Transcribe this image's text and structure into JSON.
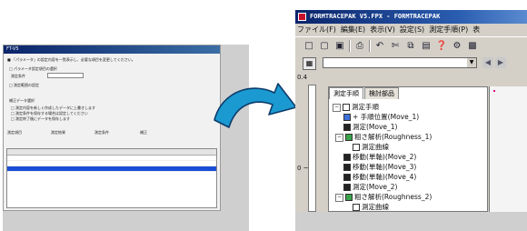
{
  "left_dialog": {
    "title": "FT-V5",
    "lines": [
      "■ 「パラメータ」の設定内容を一覧表示し、必要な項目を変更してください。",
      "□ パラメータ設定項目の選択",
      "測定条件",
      "□ 測定範囲の設定",
      "補正データ選択",
      "□ 測定内容を新しく作成したデータに上書きします",
      "□ 測定条件を保存する場合は設定してください",
      "□ 測定終了後にデータを保存します"
    ],
    "table_headers": [
      "測定項目",
      "測定結果",
      "測定条件",
      "補正"
    ]
  },
  "app": {
    "title": "FORMTRACEPAK V5.FPX - FORMTRACEPAK",
    "menu": [
      "ファイル(F)",
      "編集(E)",
      "表示(V)",
      "設定(S)",
      "測定手順(P)",
      "表"
    ],
    "ruler_labels": [
      "0.4",
      "0 ~"
    ],
    "tabs": [
      "測定手順",
      "検討部品"
    ],
    "tree": [
      {
        "label": "測定手順",
        "depth": 0,
        "toggle": "−",
        "icon": "list"
      },
      {
        "label": "+ 手順位置(Move_1)",
        "depth": 1,
        "toggle": "",
        "icon": "move"
      },
      {
        "label": "測定(Move_1)",
        "depth": 1,
        "toggle": "",
        "icon": "measure"
      },
      {
        "label": "粗さ解析(Roughness_1)",
        "depth": 1,
        "toggle": "−",
        "icon": "analysis"
      },
      {
        "label": "測定曲線",
        "depth": 2,
        "toggle": "",
        "icon": "curve"
      },
      {
        "label": "移動(単軸)(Move_2)",
        "depth": 1,
        "toggle": "",
        "icon": "axis"
      },
      {
        "label": "移動(単軸)(Move_3)",
        "depth": 1,
        "toggle": "",
        "icon": "axis"
      },
      {
        "label": "移動(単軸)(Move_4)",
        "depth": 1,
        "toggle": "",
        "icon": "axis"
      },
      {
        "label": "測定(Move_2)",
        "depth": 1,
        "toggle": "",
        "icon": "measure"
      },
      {
        "label": "粗さ解析(Roughness_2)",
        "depth": 1,
        "toggle": "−",
        "icon": "analysis"
      },
      {
        "label": "測定曲線",
        "depth": 2,
        "toggle": "",
        "icon": "curve"
      }
    ]
  }
}
